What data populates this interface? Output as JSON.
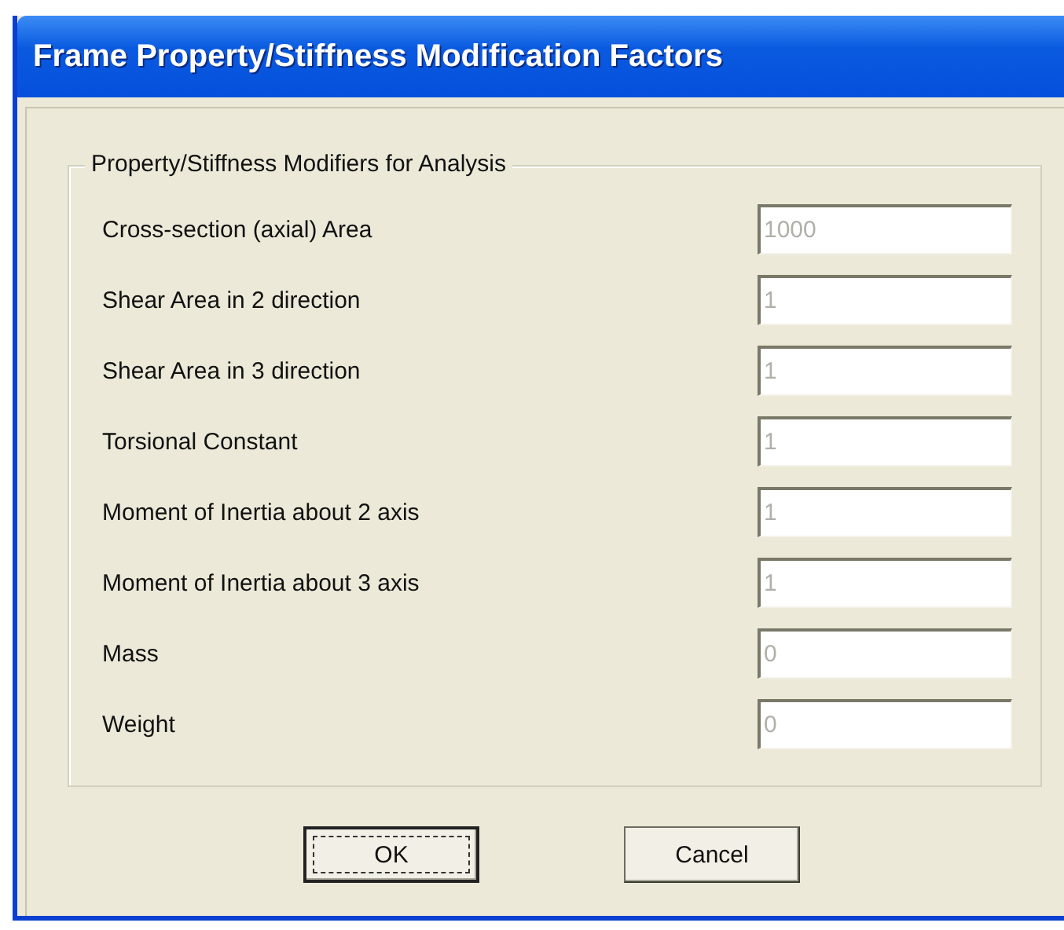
{
  "window": {
    "title": "Frame Property/Stiffness Modification Factors"
  },
  "group": {
    "title": "Property/Stiffness Modifiers for Analysis"
  },
  "fields": [
    {
      "label": "Cross-section (axial) Area",
      "value": "1000",
      "disabled": true
    },
    {
      "label": "Shear Area in 2 direction",
      "value": "1",
      "disabled": true
    },
    {
      "label": "Shear Area in 3 direction",
      "value": "1",
      "disabled": true
    },
    {
      "label": "Torsional Constant",
      "value": "1",
      "disabled": true
    },
    {
      "label": "Moment of Inertia about 2 axis",
      "value": "1",
      "disabled": true
    },
    {
      "label": "Moment of Inertia about 3 axis",
      "value": "1",
      "disabled": true
    },
    {
      "label": "Mass",
      "value": "0",
      "disabled": true
    },
    {
      "label": "Weight",
      "value": "0",
      "disabled": true
    }
  ],
  "buttons": [
    {
      "label": "OK",
      "focused": true
    },
    {
      "label": "Cancel",
      "focused": false
    }
  ]
}
